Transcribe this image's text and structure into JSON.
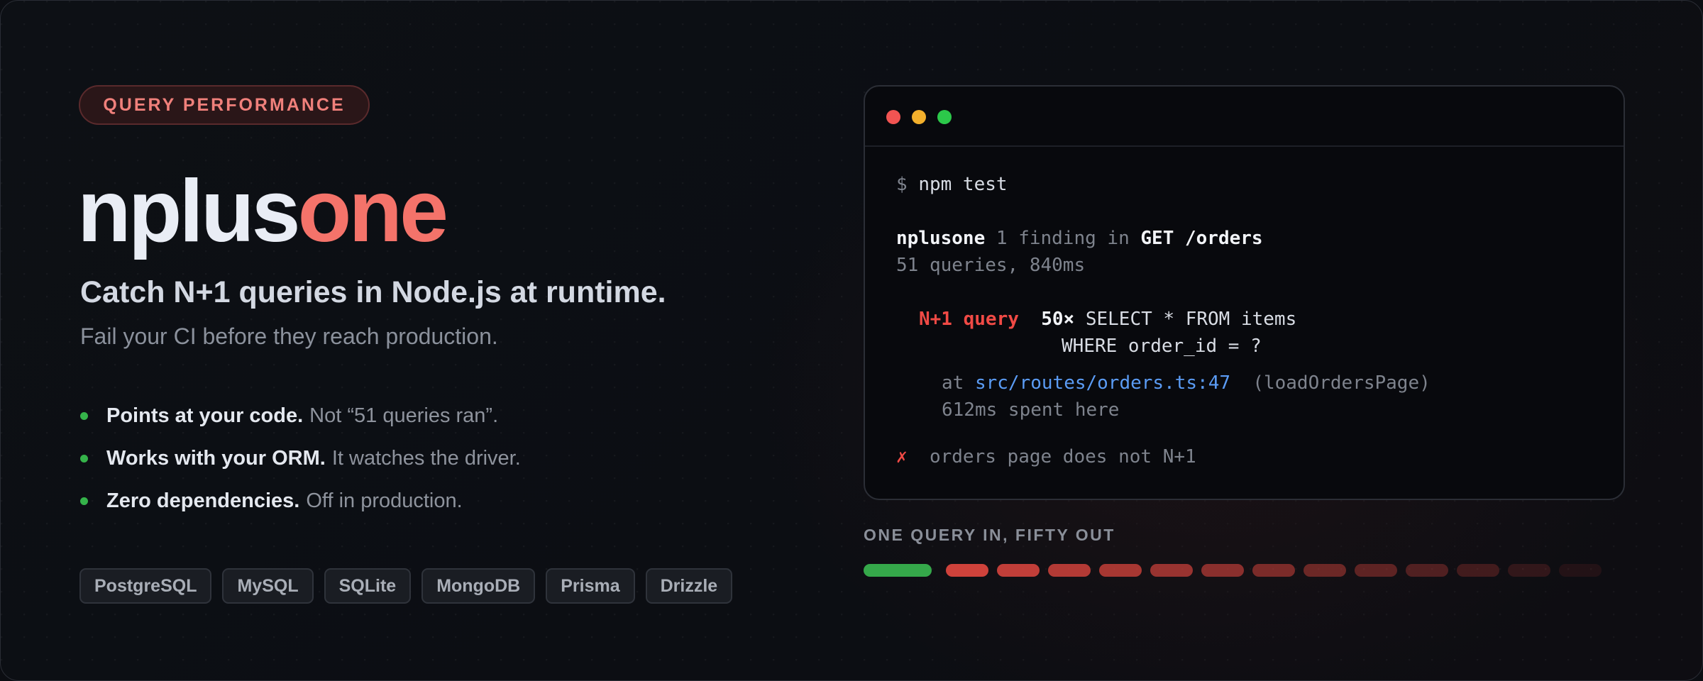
{
  "badge": "QUERY PERFORMANCE",
  "title": {
    "part1": "nplus",
    "part2": "one"
  },
  "tagline": "Catch N+1 queries in Node.js at runtime.",
  "subtagline": "Fail your CI before they reach production.",
  "features": [
    {
      "bold": "Points at your code.",
      "rest": "Not “51 queries ran”."
    },
    {
      "bold": "Works with your ORM.",
      "rest": "It watches the driver."
    },
    {
      "bold": "Zero dependencies.",
      "rest": "Off in production."
    }
  ],
  "tags": [
    "PostgreSQL",
    "MySQL",
    "SQLite",
    "MongoDB",
    "Prisma",
    "Drizzle"
  ],
  "terminal": {
    "prompt": "$",
    "command": "npm test",
    "tool": "nplusone",
    "finding_text": "1 finding in",
    "route": "GET /orders",
    "summary": "51 queries, 840ms",
    "issue_label": "N+1 query",
    "multiplier": "50×",
    "sql_line1": "SELECT * FROM items",
    "sql_line2": "WHERE order_id = ?",
    "at": "at",
    "location": "src/routes/orders.ts:47",
    "function": "(loadOrdersPage)",
    "time_spent": "612ms spent here",
    "fail_mark": "✗",
    "fail_text": "orders page does not N+1"
  },
  "graphic": {
    "caption": "ONE QUERY IN, FIFTY OUT",
    "colors": {
      "in": "#35a84a",
      "out": "#e0473f"
    },
    "in_count": 1,
    "out_segments": 13
  }
}
